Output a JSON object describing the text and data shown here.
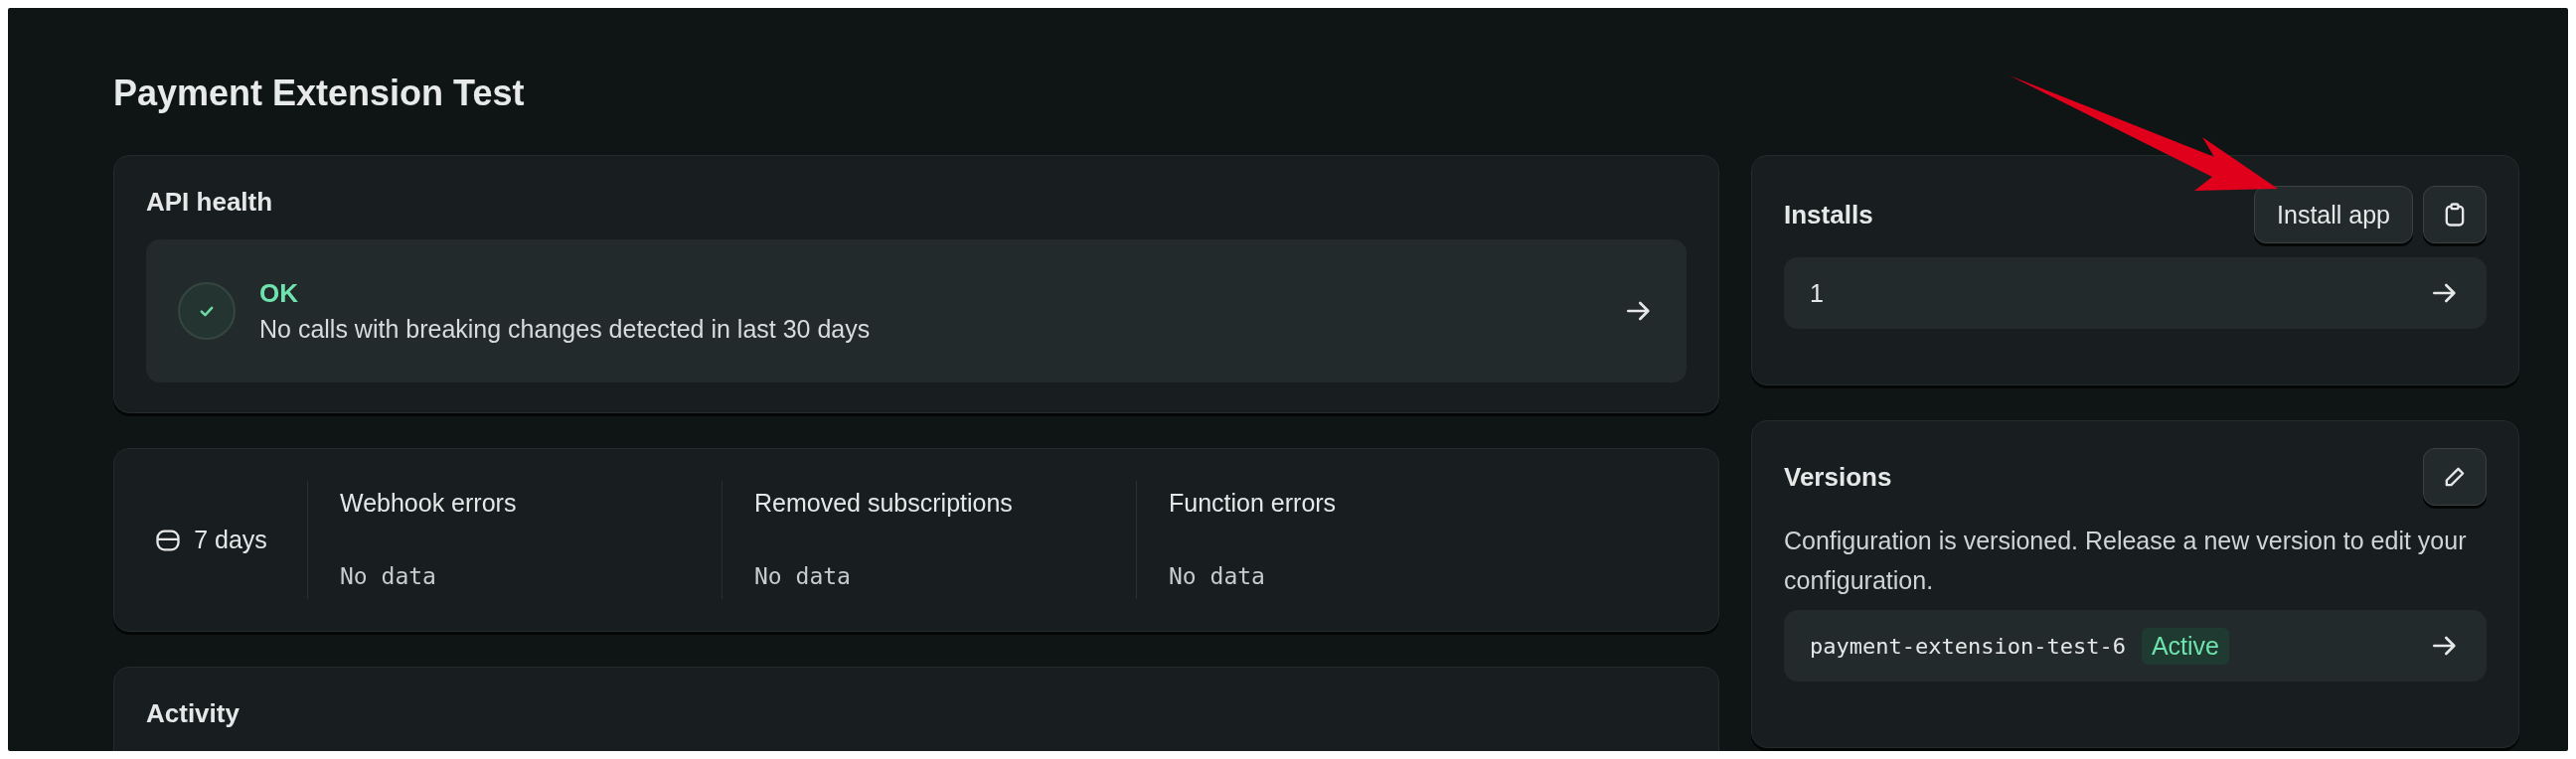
{
  "page": {
    "title": "Payment Extension Test"
  },
  "api_health": {
    "title": "API health",
    "status": "OK",
    "message": "No calls with breaking changes detected in last 30 days"
  },
  "metrics": {
    "period": "7 days",
    "items": [
      {
        "label": "Webhook errors",
        "value": "No data"
      },
      {
        "label": "Removed subscriptions",
        "value": "No data"
      },
      {
        "label": "Function errors",
        "value": "No data"
      }
    ]
  },
  "activity": {
    "title": "Activity"
  },
  "installs": {
    "title": "Installs",
    "install_button": "Install app",
    "count": "1"
  },
  "versions": {
    "title": "Versions",
    "description": "Configuration is versioned. Release a new version to edit your configuration.",
    "version": "payment-extension-test-6",
    "badge": "Active"
  }
}
